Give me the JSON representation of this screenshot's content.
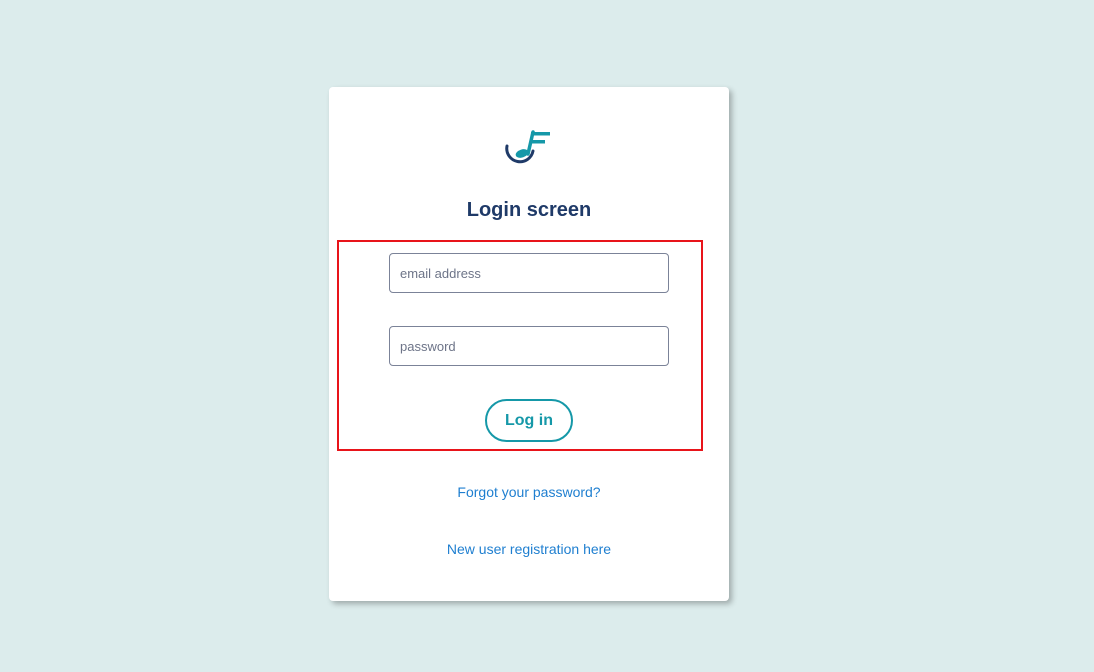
{
  "login": {
    "title": "Login screen",
    "email": {
      "placeholder": "email address",
      "value": ""
    },
    "password": {
      "placeholder": "password",
      "value": ""
    },
    "login_button_label": "Log in",
    "forgot_password_link": "Forgot your password?",
    "register_link": "New user registration here"
  },
  "logo": {
    "icon": "music-note-logo-icon"
  },
  "colors": {
    "background": "#dcecec",
    "card": "#ffffff",
    "title": "#1f3a68",
    "accent": "#1598a8",
    "link": "#1f7fd0",
    "highlight_border": "#e8141a"
  }
}
